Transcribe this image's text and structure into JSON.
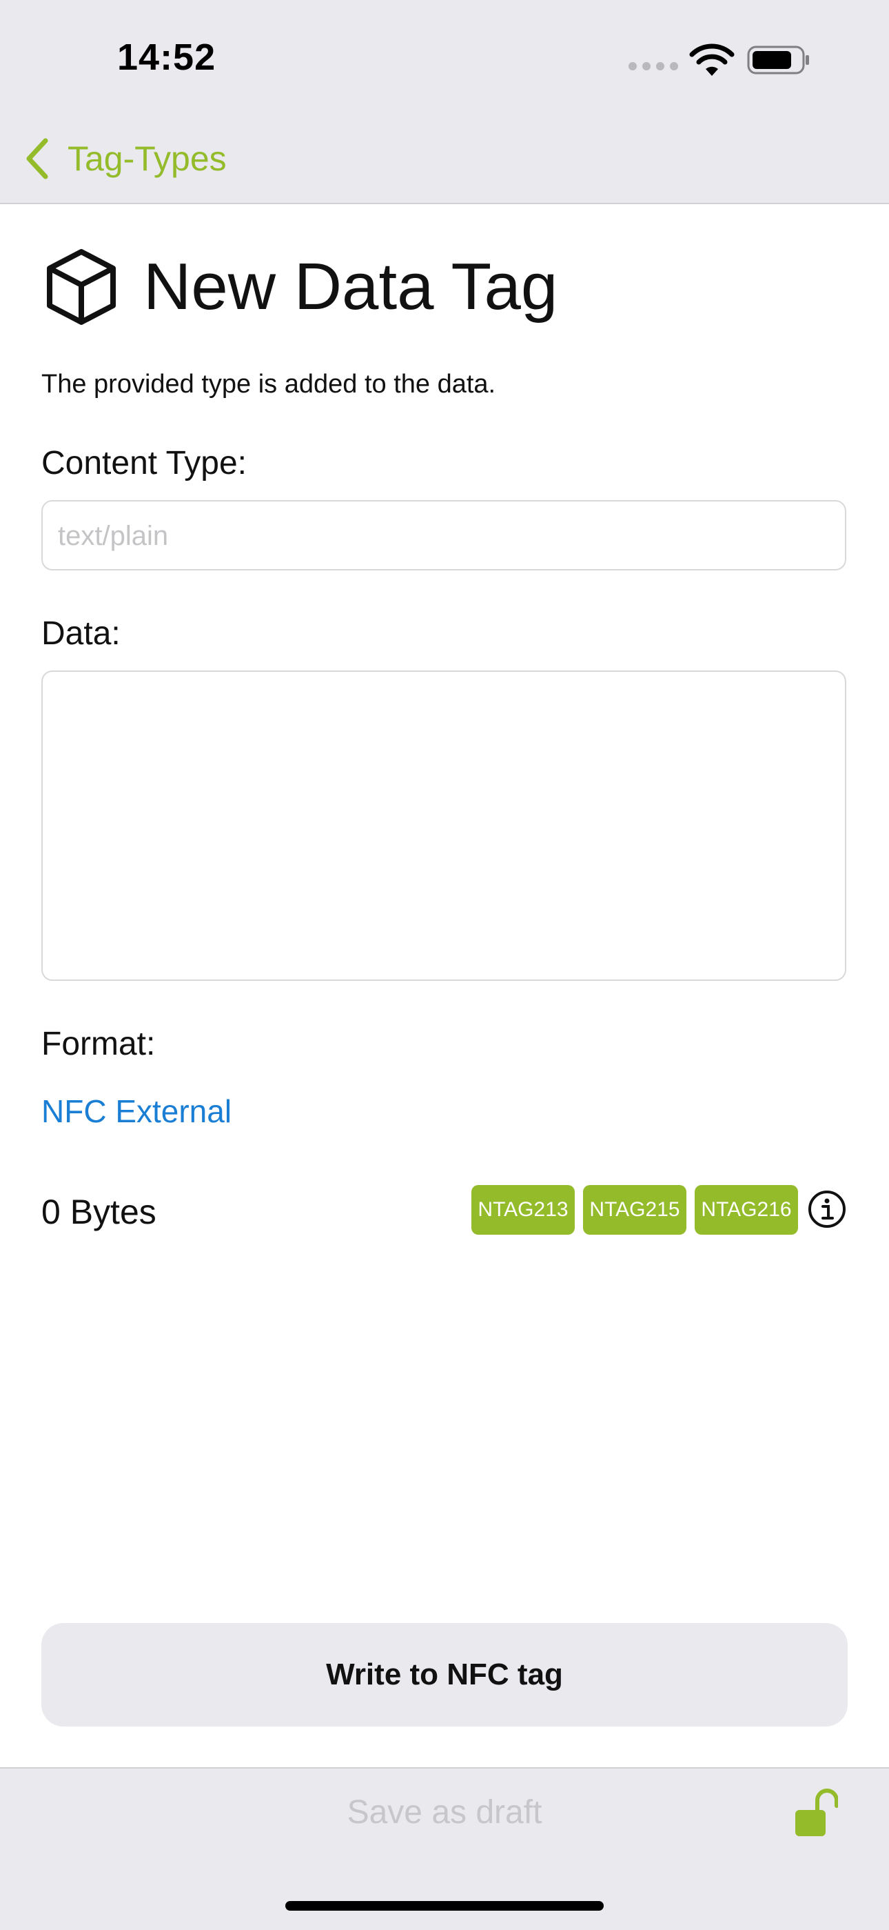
{
  "status_bar": {
    "time": "14:52"
  },
  "nav": {
    "back_label": "Tag-Types"
  },
  "header": {
    "title": "New Data Tag",
    "subtitle": "The provided type is added to the data."
  },
  "form": {
    "content_type_label": "Content Type:",
    "content_type_placeholder": "text/plain",
    "content_type_value": "",
    "data_label": "Data:",
    "data_value": "",
    "format_label": "Format:",
    "format_value": "NFC External"
  },
  "size": {
    "bytes_text": "0 Bytes",
    "chips": [
      "NTAG213",
      "NTAG215",
      "NTAG216"
    ]
  },
  "actions": {
    "write_button": "Write to NFC tag",
    "save_draft": "Save as draft"
  },
  "colors": {
    "accent": "#93bb2a",
    "link": "#1a7fd4",
    "bar_background": "#e9e9ee"
  },
  "icons": {
    "back": "chevron-left-icon",
    "title": "cube-icon",
    "info": "info-icon",
    "lock": "unlocked-padlock-icon"
  }
}
